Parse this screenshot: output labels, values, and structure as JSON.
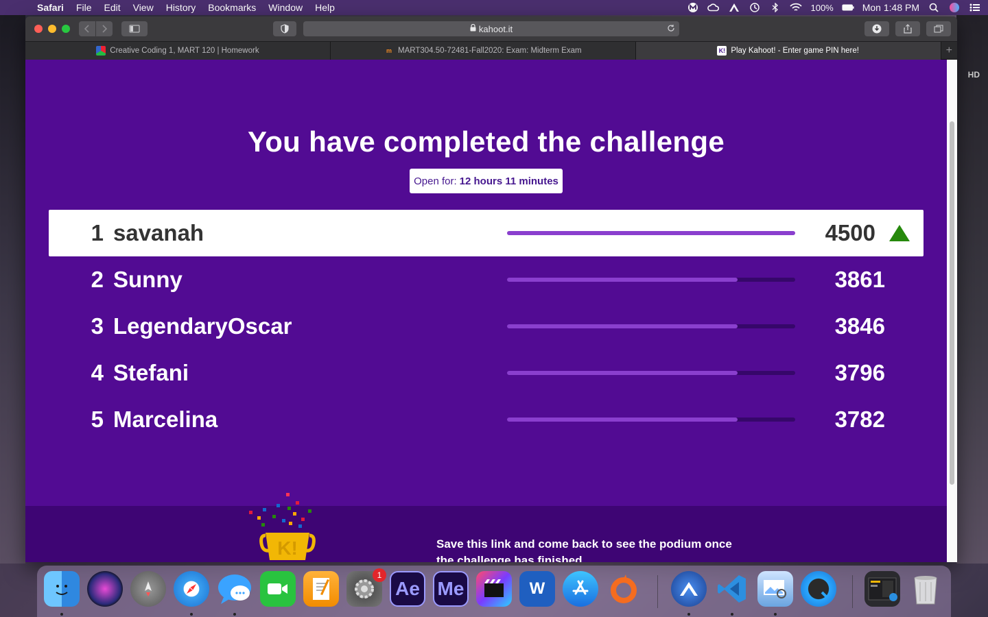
{
  "menubar": {
    "app_name": "Safari",
    "items": [
      "File",
      "Edit",
      "View",
      "History",
      "Bookmarks",
      "Window",
      "Help"
    ],
    "battery": "100%",
    "clock": "Mon 1:48 PM",
    "status_icons": [
      "malwarebytes-icon",
      "creative-cloud-icon",
      "nordvpn-icon",
      "time-machine-icon",
      "bluetooth-icon",
      "wifi-icon"
    ]
  },
  "desktop": {
    "hd_label": "HD"
  },
  "browser": {
    "url": "kahoot.it",
    "tabs": [
      {
        "title": "Creative Coding 1, MART 120 | Homework",
        "active": false
      },
      {
        "title": "MART304.50-72481-Fall2020: Exam: Midterm Exam",
        "active": false
      },
      {
        "title": "Play Kahoot! - Enter game PIN here!",
        "active": true
      }
    ],
    "favicon_k": "K!",
    "new_tab": "+"
  },
  "page": {
    "headline": "You have completed the challenge",
    "open_for_label": "Open for:",
    "open_for_value": "12 hours 11 minutes",
    "leaderboard": [
      {
        "rank": "1",
        "name": "savanah",
        "score": "4500",
        "fill": 1.0,
        "highlight": true
      },
      {
        "rank": "2",
        "name": "Sunny",
        "score": "3861",
        "fill": 0.8
      },
      {
        "rank": "3",
        "name": "LegendaryOscar",
        "score": "3846",
        "fill": 0.8
      },
      {
        "rank": "4",
        "name": "Stefani",
        "score": "3796",
        "fill": 0.8
      },
      {
        "rank": "5",
        "name": "Marcelina",
        "score": "3782",
        "fill": 0.8
      }
    ],
    "footer_text": "Save this link and come back to see the podium once the challenge has finished",
    "trophy_text": "K!"
  },
  "colors": {
    "page_bg": "#520b93",
    "footer_bg": "#3e0574",
    "bar_fill": "#8a3fce",
    "arrow_up": "#26890c"
  },
  "dock": {
    "apps": [
      "finder-icon",
      "siri-icon",
      "launchpad-icon",
      "safari-icon",
      "messages-icon",
      "facetime-icon",
      "pages-icon",
      "system-preferences-icon",
      "after-effects-icon",
      "media-encoder-icon",
      "final-cut-pro-icon",
      "word-icon",
      "app-store-icon",
      "origin-icon",
      "nordvpn-icon",
      "vscode-icon",
      "preview-icon",
      "quicktime-icon",
      "screenshot-stack-icon",
      "trash-icon"
    ],
    "ae_label": "Ae",
    "me_label": "Me",
    "word_label": "W",
    "badge": "1"
  }
}
